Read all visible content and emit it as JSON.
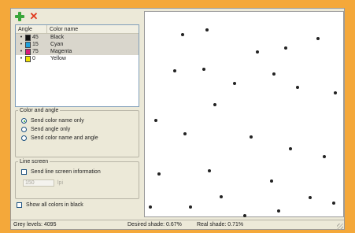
{
  "toolbar": {
    "add_icon": "plus-icon",
    "remove_icon": "x-icon"
  },
  "list": {
    "headers": [
      "Angle",
      "Color name"
    ],
    "rows": [
      {
        "angle": "45",
        "name": "Black",
        "color": "#111111",
        "selected": true
      },
      {
        "angle": "15",
        "name": "Cyan",
        "color": "#1ea0dc",
        "selected": true
      },
      {
        "angle": "75",
        "name": "Magenta",
        "color": "#d81b7a",
        "selected": true
      },
      {
        "angle": "0",
        "name": "Yellow",
        "color": "#f0e000",
        "selected": false
      }
    ]
  },
  "color_angle": {
    "legend": "Color and angle",
    "options": [
      "Send color name only",
      "Send angle only",
      "Send color name and angle"
    ],
    "selected_index": 0
  },
  "line_screen": {
    "legend": "Line screen",
    "checkbox_label": "Send line screen information",
    "value": "150",
    "unit": "lpi"
  },
  "show_black_label": "Show all colors in black",
  "status": {
    "grey_levels": "Grey levels: 4095",
    "desired": "Desired shade: 0.67%",
    "real": "Real shade: 0.71%"
  }
}
